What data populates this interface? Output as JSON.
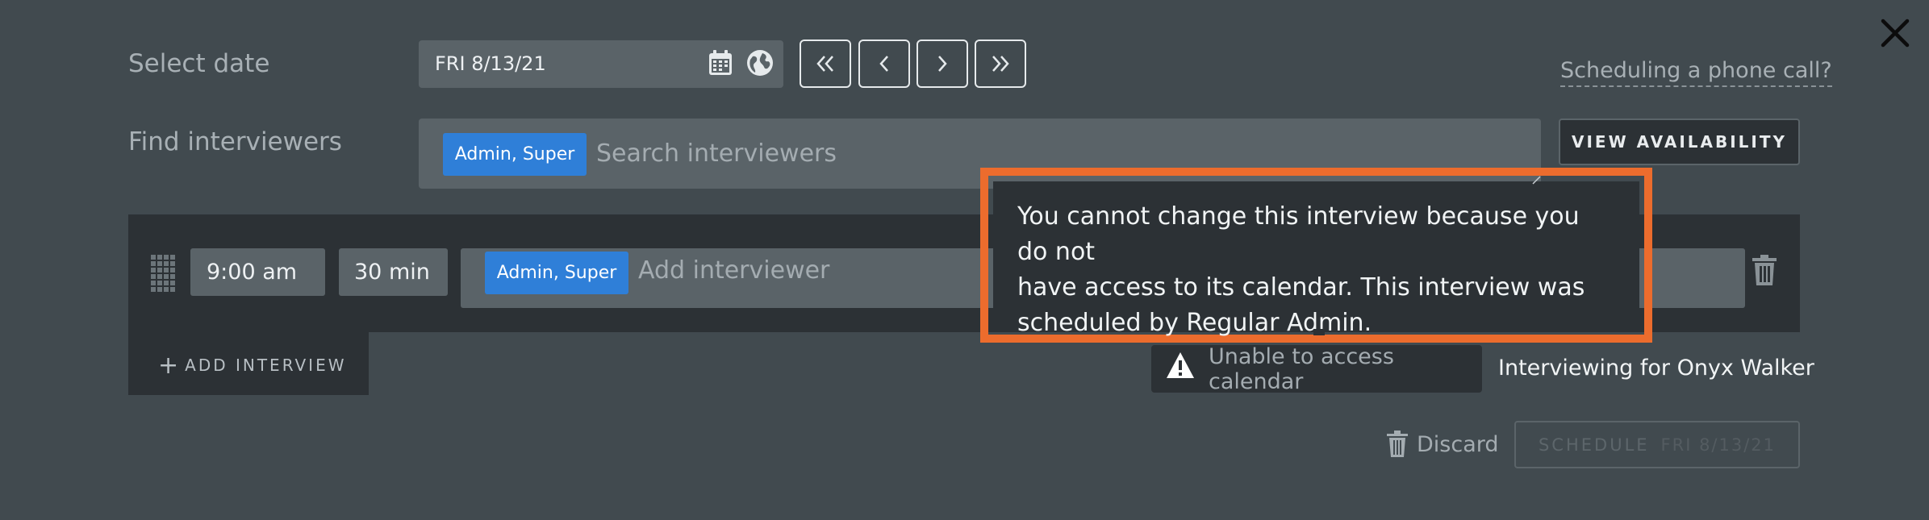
{
  "header": {
    "select_date_label": "Select date",
    "date_value": "FRI 8/13/21",
    "phone_link": "Scheduling a phone call?"
  },
  "finder": {
    "label": "Find interviewers",
    "chip": "Admin, Super",
    "search_placeholder": "Search interviewers",
    "view_availability": "VIEW AVAILABILITY"
  },
  "interview_row": {
    "time": "9:00 am",
    "duration": "30 min",
    "interviewer_chip": "Admin, Super",
    "add_placeholder": "Add interviewer"
  },
  "add_interview": "ADD INTERVIEW",
  "status": {
    "warning": "Unable to access calendar",
    "interviewing_for": "Interviewing for Onyx Walker"
  },
  "footer": {
    "discard": "Discard",
    "schedule": "SCHEDULE",
    "schedule_date": "FRI 8/13/21"
  },
  "tooltip": {
    "line1": "You cannot change this interview because you do not",
    "line2": "have access to its calendar. This interview was",
    "line3": "scheduled by Regular Admin."
  },
  "colors": {
    "background": "#414a4f",
    "panel": "#2c3135",
    "field": "#5a6368",
    "chip": "#2f7fd8",
    "highlight": "#ec6c2d"
  }
}
